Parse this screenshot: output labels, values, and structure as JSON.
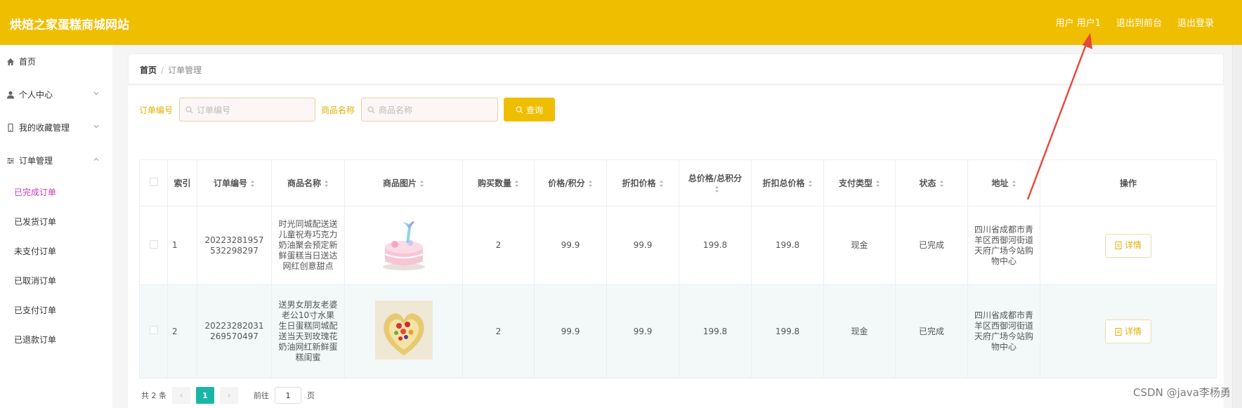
{
  "header": {
    "brand": "烘焙之家蛋糕商城网站",
    "user_label": "用户 用户1",
    "front_link": "退出到前台",
    "logout_link": "退出登录"
  },
  "sidebar": {
    "home": "首页",
    "personal": "个人中心",
    "favorites": "我的收藏管理",
    "orders": "订单管理",
    "sub_items": [
      "已完成订单",
      "已发货订单",
      "未支付订单",
      "已取消订单",
      "已支付订单",
      "已退款订单"
    ]
  },
  "breadcrumb": {
    "home": "首页",
    "sep": "/",
    "current": "订单管理"
  },
  "search": {
    "order_label": "订单编号",
    "order_placeholder": "订单编号",
    "goods_label": "商品名称",
    "goods_placeholder": "商品名称",
    "query_button": "查询"
  },
  "table": {
    "headers": {
      "index": "索引",
      "order_no": "订单编号",
      "goods_name": "商品名称",
      "goods_pic": "商品图片",
      "quantity": "购买数量",
      "price": "价格/积分",
      "discount_price": "折扣价格",
      "total": "总价格/总积分",
      "discount_total": "折扣总价格",
      "pay_type": "支付类型",
      "status": "状态",
      "address": "地址",
      "action": "操作"
    },
    "rows": [
      {
        "index": "1",
        "order_no": "20223281957532298297",
        "goods_name": "时光同城配送送儿童祝寿巧克力奶油聚会预定新鲜蛋糕当日送达网红创意甜点",
        "quantity": "2",
        "price": "99.9",
        "discount_price": "99.9",
        "total": "199.8",
        "discount_total": "199.8",
        "pay_type": "现金",
        "status": "已完成",
        "address": "四川省成都市青羊区西御河街道天府广场今站购物中心",
        "detail": "详情"
      },
      {
        "index": "2",
        "order_no": "20223282031269570497",
        "goods_name": "送男女朋友老婆老公10寸水果生日蛋糕同城配送当天到玫瑰花奶油网红新鲜蛋糕闺蜜",
        "quantity": "2",
        "price": "99.9",
        "discount_price": "99.9",
        "total": "199.8",
        "discount_total": "199.8",
        "pay_type": "现金",
        "status": "已完成",
        "address": "四川省成都市青羊区西御河街道天府广场今站购物中心",
        "detail": "详情"
      }
    ]
  },
  "pagination": {
    "total": "共 2 条",
    "current": "1",
    "goto_prefix": "前往",
    "goto_value": "1",
    "goto_suffix": "页"
  },
  "watermark": "CSDN @java李杨勇",
  "colors": {
    "accent": "#f0be00",
    "active_page": "#19b6a8",
    "active_menu": "#c33db8",
    "arrow": "#e8463a"
  }
}
